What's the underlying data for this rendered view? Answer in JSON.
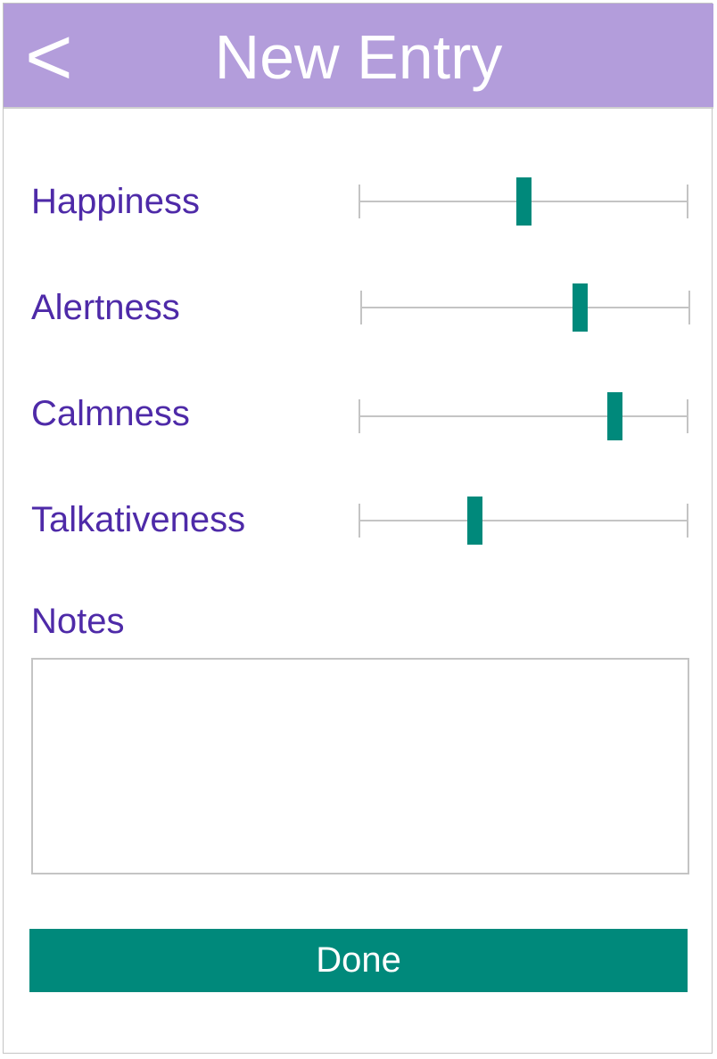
{
  "header": {
    "back_label": "<",
    "title": "New Entry"
  },
  "colors": {
    "header_bg": "#b39ddb",
    "label": "#4e2aa8",
    "accent": "#00897b"
  },
  "sliders": [
    {
      "label": "Happiness",
      "value": 0.5
    },
    {
      "label": "Alertness",
      "value": 0.665
    },
    {
      "label": "Calmness",
      "value": 0.775
    },
    {
      "label": "Talkativeness",
      "value": 0.35
    }
  ],
  "notes": {
    "label": "Notes",
    "value": ""
  },
  "done_label": "Done"
}
